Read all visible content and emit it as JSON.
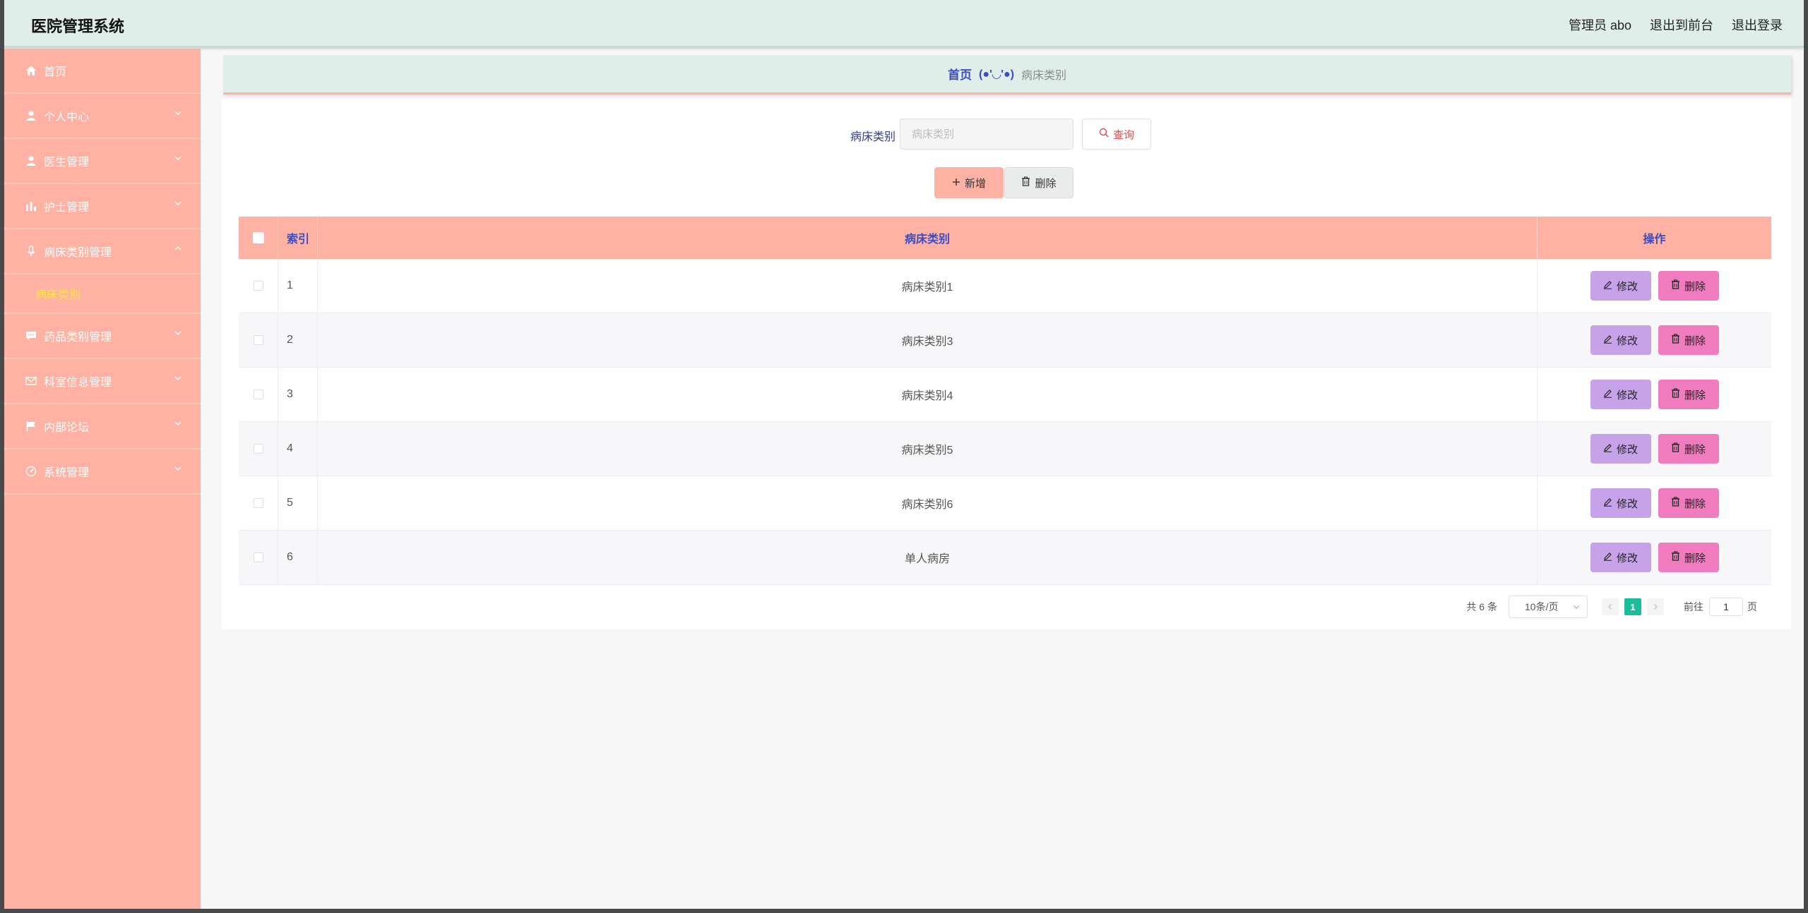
{
  "header": {
    "title": "医院管理系统",
    "user": "管理员 abo",
    "front_link": "退出到前台",
    "logout": "退出登录"
  },
  "sidebar": {
    "items": [
      {
        "label": "首页",
        "icon": "home-icon"
      },
      {
        "label": "个人中心",
        "icon": "user-icon"
      },
      {
        "label": "医生管理",
        "icon": "user-icon"
      },
      {
        "label": "护士管理",
        "icon": "bar-chart-icon"
      },
      {
        "label": "病床类别管理",
        "icon": "microphone-icon",
        "expanded": true
      },
      {
        "label": "药品类别管理",
        "icon": "chat-icon"
      },
      {
        "label": "科室信息管理",
        "icon": "mail-icon"
      },
      {
        "label": "内部论坛",
        "icon": "flag-icon"
      },
      {
        "label": "系统管理",
        "icon": "gauge-icon"
      }
    ],
    "active_sub": "病床类别"
  },
  "breadcrumb": {
    "home": "首页",
    "sep": "(●'◡'●)",
    "current": "病床类别"
  },
  "search": {
    "label": "病床类别",
    "placeholder": "病床类别",
    "button": "查询"
  },
  "actions": {
    "add": "新增",
    "delete": "删除"
  },
  "table": {
    "headers": {
      "index": "索引",
      "name": "病床类别",
      "ops": "操作"
    },
    "rows": [
      {
        "index": "1",
        "name": "病床类别1"
      },
      {
        "index": "2",
        "name": "病床类别3"
      },
      {
        "index": "3",
        "name": "病床类别4"
      },
      {
        "index": "4",
        "name": "病床类别5"
      },
      {
        "index": "5",
        "name": "病床类别6"
      },
      {
        "index": "6",
        "name": "单人病房"
      }
    ],
    "edit_label": "修改",
    "delete_label": "删除"
  },
  "pagination": {
    "total": "共 6 条",
    "page_size": "10条/页",
    "current": "1",
    "goto_label": "前往",
    "goto_value": "1",
    "unit": "页"
  },
  "colors": {
    "sidebar": "#ffb1a3",
    "header": "#e0eeea",
    "edit": "#c8a2e8",
    "delete": "#f07cbf",
    "page_active": "#1abc9c"
  }
}
